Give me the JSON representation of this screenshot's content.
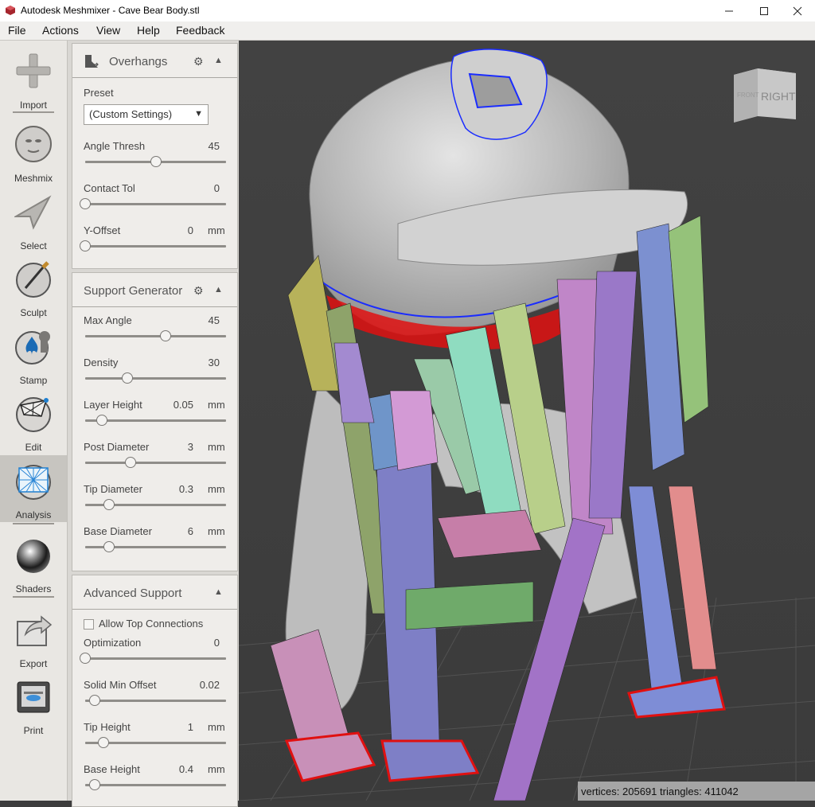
{
  "window": {
    "title": "Autodesk Meshmixer - Cave Bear Body.stl",
    "controls": [
      "minimize",
      "maximize",
      "close"
    ]
  },
  "menu": [
    "File",
    "Actions",
    "View",
    "Help",
    "Feedback"
  ],
  "toolbar": {
    "items": [
      {
        "label": "Import",
        "icon": "plus-icon"
      },
      {
        "label": "Meshmix",
        "icon": "meshmix-face-icon"
      },
      {
        "label": "Select",
        "icon": "select-arrow-icon"
      },
      {
        "label": "Sculpt",
        "icon": "sculpt-brush-icon"
      },
      {
        "label": "Stamp",
        "icon": "stamp-icon"
      },
      {
        "label": "Edit",
        "icon": "edit-mesh-icon"
      },
      {
        "label": "Analysis",
        "icon": "analysis-sphere-icon",
        "active": true
      },
      {
        "label": "Shaders",
        "icon": "shader-sphere-icon"
      },
      {
        "label": "Export",
        "icon": "export-icon"
      },
      {
        "label": "Print",
        "icon": "printer-icon"
      }
    ]
  },
  "overhangs": {
    "title": "Overhangs",
    "preset_label": "Preset",
    "preset_value": "(Custom Settings)",
    "rows": [
      {
        "label": "Angle Thresh",
        "value": "45",
        "unit": "",
        "level": 0.5
      },
      {
        "label": "Contact Tol",
        "value": "0",
        "unit": "",
        "level": 0.0
      },
      {
        "label": "Y-Offset",
        "value": "0",
        "unit": "mm",
        "level": 0.0
      }
    ]
  },
  "support_generator": {
    "title": "Support Generator",
    "rows": [
      {
        "label": "Max Angle",
        "value": "45",
        "unit": "",
        "level": 0.57
      },
      {
        "label": "Density",
        "value": "30",
        "unit": "",
        "level": 0.3
      },
      {
        "label": "Layer Height",
        "value": "0.05",
        "unit": "mm",
        "level": 0.12
      },
      {
        "label": "Post Diameter",
        "value": "3",
        "unit": "mm",
        "level": 0.32
      },
      {
        "label": "Tip Diameter",
        "value": "0.3",
        "unit": "mm",
        "level": 0.17
      },
      {
        "label": "Base Diameter",
        "value": "6",
        "unit": "mm",
        "level": 0.17
      }
    ]
  },
  "advanced_support": {
    "title": "Advanced Support",
    "checkbox_label": "Allow Top Connections",
    "rows": [
      {
        "label": "Optimization",
        "value": "0",
        "unit": "",
        "level": 0.0
      },
      {
        "label": "Solid Min Offset",
        "value": "0.02",
        "unit": "",
        "level": 0.07
      },
      {
        "label": "Tip Height",
        "value": "1",
        "unit": "mm",
        "level": 0.13
      },
      {
        "label": "Base Height",
        "value": "0.4",
        "unit": "mm",
        "level": 0.07
      }
    ]
  },
  "viewcube": {
    "front": "FRONT",
    "right": "RIGHT"
  },
  "status": "vertices: 205691 triangles: 411042",
  "colors": {
    "accent": "#3aa0d8",
    "viewport_bg": "#434343",
    "mesh": "#bdbdbd",
    "overhang_red": "#e01010",
    "overhang_outline": "#1a2cff"
  }
}
